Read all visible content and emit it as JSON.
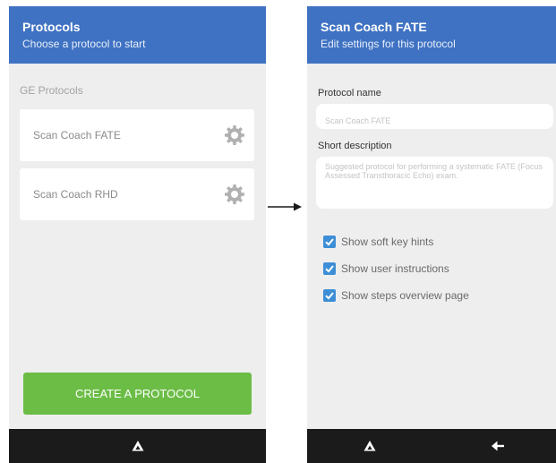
{
  "left_screen": {
    "title": "Protocols",
    "subtitle": "Choose a protocol to start",
    "section_label": "GE Protocols",
    "protocols": [
      {
        "label": "Scan Coach FATE",
        "icon": "gear-icon"
      },
      {
        "label": "Scan Coach RHD",
        "icon": "gear-icon"
      }
    ],
    "create_button": "CREATE A PROTOCOL",
    "nav_icons": [
      "home-triangle-icon"
    ]
  },
  "right_screen": {
    "title": "Scan Coach FATE",
    "subtitle": "Edit settings for this protocol",
    "name_label": "Protocol name",
    "name_value": "Scan Coach FATE",
    "description_label": "Short description",
    "description_value": "Suggested protocol for performing a systematic FATE (Focus Assessed Transthoracic Echo) exam.",
    "options": [
      {
        "label": "Show soft key hints",
        "checked": true
      },
      {
        "label": "Show user instructions",
        "checked": true
      },
      {
        "label": "Show steps overview page",
        "checked": true
      }
    ],
    "nav_icons": [
      "home-triangle-icon",
      "back-arrow-icon"
    ]
  },
  "colors": {
    "appbar": "#3f72c2",
    "screen_background": "#eeeeee",
    "create_button": "#6bbd45",
    "checkbox": "#3d8ed6",
    "navbar": "#1b1b1b"
  }
}
